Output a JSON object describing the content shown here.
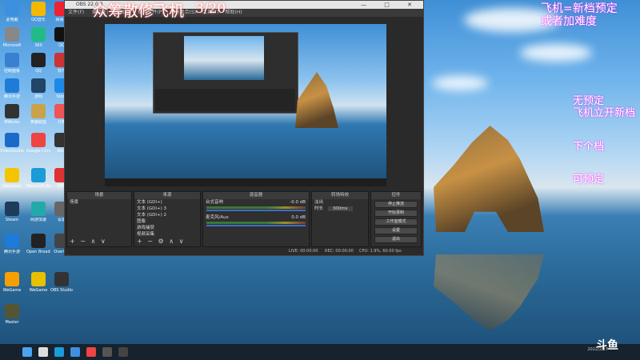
{
  "colors": {
    "accent": "#ffffff",
    "overlay_text": "#ffffff",
    "overlay_red": "#ff4a4a",
    "overlay_pink": "#ff7ad9"
  },
  "overlay": {
    "main_title": "众筹散修飞机",
    "counter": "3/20",
    "rule1_line1": "飞机=新档预定",
    "rule1_line2": "或者加难度",
    "rule2_line1": "无预定",
    "rule2_line2": "飞机立开新档",
    "rule3": "下个档",
    "rule4": "可预定"
  },
  "obs": {
    "title": "OBS 22.0.3",
    "menu": [
      "文件(F)",
      "编辑(E)",
      "视图(V)",
      "配置文件(P)",
      "场景集合(S)",
      "工具(T)",
      "帮助(H)"
    ],
    "window_controls": "— □ ✕"
  },
  "docks": {
    "scenes": {
      "header": "场景",
      "items": [
        "场景"
      ]
    },
    "sources": {
      "header": "来源",
      "items": [
        "文本 (GDI+)",
        "文本 (GDI+) 3",
        "文本 (GDI+) 2",
        "图像",
        "游戏捕获",
        "视频采集"
      ]
    },
    "mixer": {
      "header": "混音器",
      "channels": [
        {
          "name": "台式音响",
          "db": "-0.0 dB"
        },
        {
          "name": "麦克风/Aux",
          "db": "0.0 dB"
        }
      ]
    },
    "transitions": {
      "header": "转场特效",
      "type": "淡出",
      "duration_label": "时长",
      "duration_value": "300ms"
    },
    "controls": {
      "header": "控件",
      "buttons": [
        "停止推流",
        "开始录制",
        "工作室模式",
        "设置",
        "退出"
      ]
    }
  },
  "status": {
    "live": "LIVE: 00:00:00",
    "rec": "REC: 00:00:00",
    "cpu": "CPU: 1.9%, 60.00 fps"
  },
  "desktop_icons": [
    {
      "label": "此电脑",
      "color": "#3d8fe0"
    },
    {
      "label": "QQ音乐",
      "color": "#f5b800"
    },
    {
      "label": "网易云",
      "color": "#e23"
    },
    {
      "label": "Microsoft",
      "color": "#888"
    },
    {
      "label": "360",
      "color": "#2b8"
    },
    {
      "label": "QQ",
      "color": "#111"
    },
    {
      "label": "控制面板",
      "color": "#3a7fd0"
    },
    {
      "label": "QQ",
      "color": "#222"
    },
    {
      "label": "软件",
      "color": "#c33"
    },
    {
      "label": "腾讯手游",
      "color": "#1e7cd8"
    },
    {
      "label": "游戏",
      "color": "#246"
    },
    {
      "label": "Store",
      "color": "#1e88e5"
    },
    {
      "label": "MWorks",
      "color": "#333"
    },
    {
      "label": "英雄联盟",
      "color": "#c9a24a"
    },
    {
      "label": "计算",
      "color": "#e55"
    },
    {
      "label": "VideoStudio",
      "color": "#1a6ac9"
    },
    {
      "label": "Google Chrome",
      "color": "#e44"
    },
    {
      "label": "Alex",
      "color": "#333"
    },
    {
      "label": "WeGame",
      "color": "#f5c400"
    },
    {
      "label": "Microsoft Edge",
      "color": "#1b9bd8"
    },
    {
      "label": "WPS",
      "color": "#d33"
    },
    {
      "label": "Steam",
      "color": "#1e3b5a"
    },
    {
      "label": "网游加速",
      "color": "#2aa"
    },
    {
      "label": "设置",
      "color": "#666"
    },
    {
      "label": "腾讯手游",
      "color": "#1e7cd8"
    },
    {
      "label": "Open Broadcaster",
      "color": "#222"
    },
    {
      "label": "Overlay",
      "color": "#444"
    },
    {
      "label": "WeGame",
      "color": "#f5a000"
    },
    {
      "label": "WeGame",
      "color": "#e8c000"
    },
    {
      "label": "OBS Studio",
      "color": "#333"
    },
    {
      "label": "Master",
      "color": "#553"
    }
  ],
  "taskbar": {
    "date": "2022/2/27"
  },
  "watermark": "斗鱼"
}
